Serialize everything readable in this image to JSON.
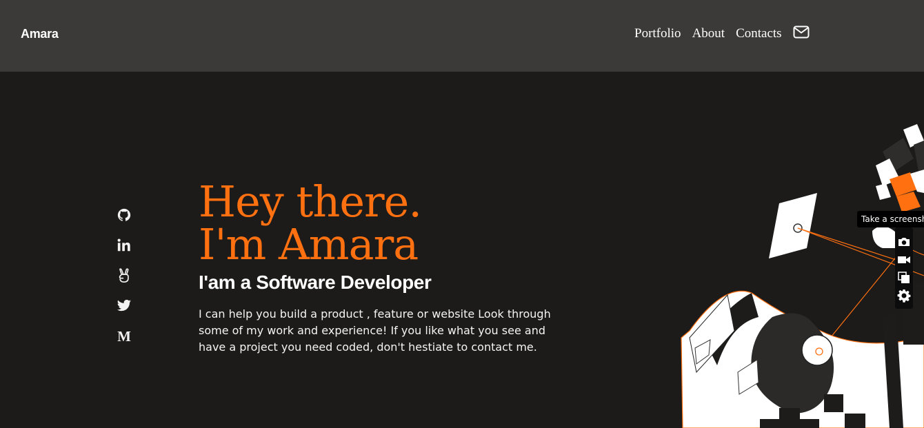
{
  "brand": "Amara",
  "nav": {
    "portfolio": "Portfolio",
    "about": "About",
    "contacts": "Contacts"
  },
  "social_icons": [
    "github-icon",
    "linkedin-icon",
    "angellist-icon",
    "twitter-icon",
    "medium-icon"
  ],
  "social_medium_letter": "M",
  "hero": {
    "line1": "Hey there.",
    "line2": "I'm Amara",
    "subtitle": "I'am a Software Developer",
    "description": "I can help you build a product , feature or website Look through some of my work and experience! If you like what you see and have a project you need coded, don't hestiate to contact me."
  },
  "extension": {
    "tooltip": "Take a screensh"
  },
  "colors": {
    "accent": "#ff7010",
    "header_bg": "#3b3a39",
    "page_bg": "#1c1b1a"
  }
}
